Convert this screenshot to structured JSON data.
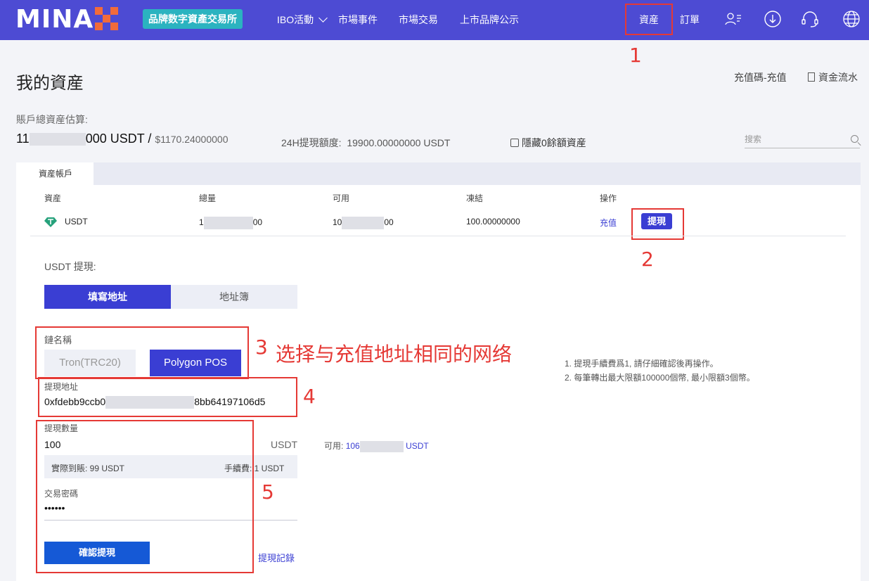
{
  "header": {
    "logo_text": "MINA",
    "brand_badge": "品牌数字資產交易所",
    "nav": {
      "ibo": "IBO活動",
      "events": "市場事件",
      "trade": "市場交易",
      "listing": "上市品牌公示",
      "assets": "資産",
      "orders": "訂單"
    }
  },
  "annotations": {
    "n1": "1",
    "n2": "2",
    "n3": "3",
    "n4": "4",
    "n5": "5",
    "note3": "选择与充值地址相同的网络"
  },
  "page": {
    "title": "我的資産",
    "recharge_link": "充值碼-充值",
    "flow_link": "資金流水",
    "estimate_label": "賬戶總資産估算:",
    "total_prefix": "11",
    "total_suffix": "000 USDT",
    "total_sep": " / ",
    "total_usd": "$1170.24000000",
    "limit_label": "24H提現額度:",
    "limit_value": "19900.00000000 USDT",
    "hide_zero": "隱藏0餘額資産",
    "search_placeholder": "搜索"
  },
  "tabs": {
    "asset_account": "資産帳戶"
  },
  "table": {
    "headers": [
      "資産",
      "總量",
      "可用",
      "凍結",
      "操作"
    ],
    "row": {
      "asset": "USDT",
      "total_prefix": "1",
      "total_suffix": "00",
      "available_prefix": "10",
      "available_suffix": "00",
      "frozen": "100.00000000",
      "deposit": "充值",
      "withdraw": "提現"
    }
  },
  "withdraw": {
    "title": "USDT 提現:",
    "seg_fill": "填寫地址",
    "seg_book": "地址簿",
    "chain_label": "鏈名稱",
    "chain_tron": "Tron(TRC20)",
    "chain_polygon": "Polygon POS",
    "addr_label": "提現地址",
    "addr_prefix": "0xfdebb9ccb0",
    "addr_suffix": "8bb64197106d5",
    "amount_label": "提現數量",
    "amount_value": "100",
    "amount_unit": "USDT",
    "available_label": "可用:",
    "available_prefix": "106",
    "available_unit": "USDT",
    "actual_label": "實際到賬: 99 USDT",
    "fee_label": "手續費: 1 USDT",
    "pwd_label": "交易密碼",
    "pwd_value": "••••••",
    "confirm": "確認提現",
    "records": "提現記錄",
    "notes": [
      "1. 提現手續費爲1, 請仔細確認後再操作。",
      "2. 每筆轉出最大限額100000個幣, 最小限額3個幣。"
    ]
  },
  "colors": {
    "header_bg": "#4d4bd3",
    "accent": "#3a3ed3",
    "badge": "#2bb3c0",
    "annotation_red": "#e53935",
    "logo_x": "#f26b3a"
  }
}
